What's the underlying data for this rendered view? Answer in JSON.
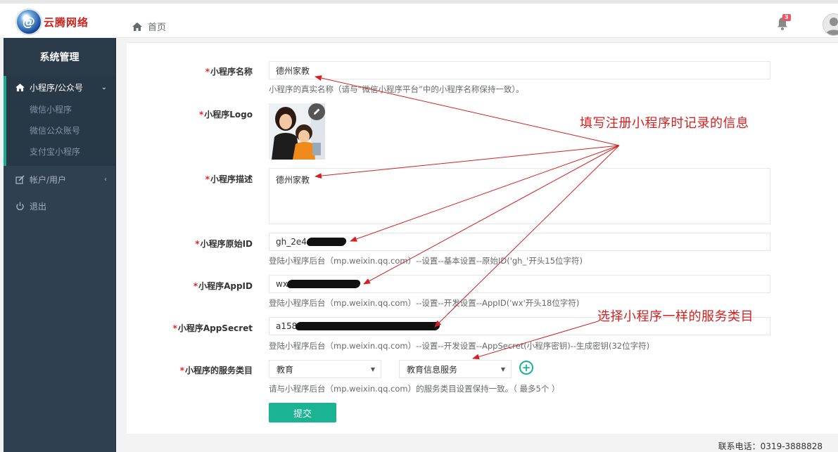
{
  "header": {
    "logo_text": "云腾网络",
    "breadcrumb_home": "首页",
    "notification_count": "3"
  },
  "sidebar": {
    "title": "系统管理",
    "menu": {
      "label": "小程序/公众号",
      "items": [
        "微信小程序",
        "微信公众账号",
        "支付宝小程序"
      ]
    },
    "account": "帐户/用户",
    "logout": "退出"
  },
  "form": {
    "required_mark": "*",
    "name": {
      "label": "小程序名称",
      "value": "德州家教",
      "help": "小程序的真实名称（请与“微信小程序平台”中的小程序名称保持一致）。"
    },
    "logo": {
      "label": "小程序Logo"
    },
    "description": {
      "label": "小程序描述",
      "value": "德州家教"
    },
    "original_id": {
      "label": "小程序原始ID",
      "value": "gh_2e4",
      "help": "登陆小程序后台（mp.weixin.qq.com）--设置--基本设置--原始ID('gh_'开头15位字符)"
    },
    "appid": {
      "label": "小程序AppID",
      "value": "wx4",
      "help": "登陆小程序后台（mp.weixin.qq.com）--设置--开发设置--AppID('wx'开头18位字符)"
    },
    "appsecret": {
      "label": "小程序AppSecret",
      "value": "a158",
      "help": "登陆小程序后台（mp.weixin.qq.com）--设置--开发设置--AppSecret(小程序密钥)--生成密钥(32位字符)"
    },
    "category": {
      "label": "小程序的服务类目",
      "primary": "教育",
      "secondary": "教育信息服务",
      "help": "请与小程序后台（mp.weixin.qq.com）的服务类目设置保持一致。（ 最多5个 ）"
    },
    "submit": "提交"
  },
  "annotations": {
    "fill_info": "填写注册小程序时记录的信息",
    "choose_category": "选择小程序一样的服务类目"
  },
  "footer": {
    "phone": "联系电话：0319-3888828"
  },
  "colors": {
    "accent": "#1ab394",
    "annotation": "#d62020",
    "sidebar": "#2f4050",
    "required": "#ed1c24"
  }
}
